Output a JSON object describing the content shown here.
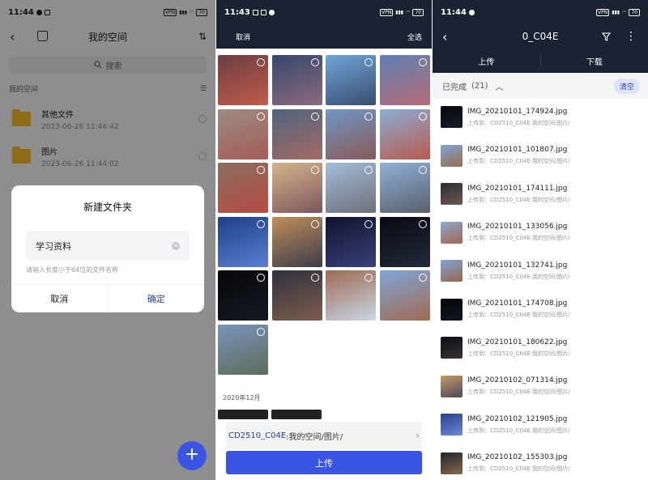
{
  "panel1": {
    "status": {
      "time": "11:44",
      "vpn": "VPN",
      "battery": "70"
    },
    "title": "我的空间",
    "search_placeholder": "搜索",
    "section_label": "我的空间",
    "files": [
      {
        "name": "其他文件",
        "date": "2023-06-26 11:44:42"
      },
      {
        "name": "图片",
        "date": "2023-06-26 11:44:02"
      }
    ],
    "dialog": {
      "title": "新建文件夹",
      "input_value": "学习资料",
      "hint": "请输入长度小于64位的文件名称",
      "cancel": "取消",
      "confirm": "确定"
    },
    "fab_label": "+"
  },
  "panel2": {
    "status": {
      "time": "11:43",
      "vpn": "VPN",
      "battery": "70"
    },
    "cancel": "取消",
    "select_all": "全选",
    "month_label": "2020年12月",
    "thumbs": [
      {
        "c1": "#6b3e43",
        "c2": "#c25c4b"
      },
      {
        "c1": "#36476c",
        "c2": "#8c6a7d"
      },
      {
        "c1": "#6fa5d8",
        "c2": "#3b4d6f"
      },
      {
        "c1": "#5b80b3",
        "c2": "#b86b78"
      },
      {
        "c1": "#9b8c82",
        "c2": "#a65b58"
      },
      {
        "c1": "#4f647f",
        "c2": "#a36a62"
      },
      {
        "c1": "#6f96c7",
        "c2": "#8a5a57"
      },
      {
        "c1": "#8aaed6",
        "c2": "#b8594b"
      },
      {
        "c1": "#8b6d61",
        "c2": "#b54c43"
      },
      {
        "c1": "#d6b58a",
        "c2": "#7e555d"
      },
      {
        "c1": "#a3bddb",
        "c2": "#6e6f79"
      },
      {
        "c1": "#8fb1d8",
        "c2": "#5a5f6c"
      },
      {
        "c1": "#1f3f86",
        "c2": "#5a7fd1"
      },
      {
        "c1": "#c08e58",
        "c2": "#3c3c4a"
      },
      {
        "c1": "#10142c",
        "c2": "#3b3f7a"
      },
      {
        "c1": "#080a12",
        "c2": "#232a3a"
      },
      {
        "c1": "#06070a",
        "c2": "#151922"
      },
      {
        "c1": "#2f3140",
        "c2": "#7d5d4c"
      },
      {
        "c1": "#9e6a52",
        "c2": "#c9d6e6"
      },
      {
        "c1": "#7ea6d8",
        "c2": "#a26a52"
      },
      {
        "c1": "#7893bd",
        "c2": "#5e6d58"
      }
    ],
    "dest_device": "CD2510_C04E",
    "dest_path": ":我的空间/图片/",
    "upload": "上传"
  },
  "panel3": {
    "status": {
      "time": "11:44",
      "vpn": "VPN",
      "battery": "70"
    },
    "title": "0_C04E",
    "tab_upload": "上传",
    "tab_download": "下载",
    "done_label": "已完成",
    "done_count": "(21)",
    "clear": "清空",
    "items": [
      {
        "name": "IMG_20210101_174924.jpg",
        "dest": "上传到：CD2510_C04E 我的空间/图片/",
        "c1": "#05060a",
        "c2": "#1a1e2a"
      },
      {
        "name": "IMG_20210101_101807.jpg",
        "dest": "上传到：CD2510_C04E 我的空间/图片/",
        "c1": "#7fa7d6",
        "c2": "#9b6a4d"
      },
      {
        "name": "IMG_20210101_174111.jpg",
        "dest": "上传到：CD2510_C04E 我的空间/图片/",
        "c1": "#2a2c36",
        "c2": "#6d5a4e"
      },
      {
        "name": "IMG_20210101_133056.jpg",
        "dest": "上传到：CD2510_C04E 我的空间/图片/",
        "c1": "#8ba9cf",
        "c2": "#a66452"
      },
      {
        "name": "IMG_20210101_132741.jpg",
        "dest": "上传到：CD2510_C04E 我的空间/图片/",
        "c1": "#7ea5d5",
        "c2": "#9a6550"
      },
      {
        "name": "IMG_20210101_174708.jpg",
        "dest": "上传到：CD2510_C04E 我的空间/图片/",
        "c1": "#05060a",
        "c2": "#121620"
      },
      {
        "name": "IMG_20210101_180622.jpg",
        "dest": "上传到：CD2510_C04E 我的空间/图片/",
        "c1": "#0b0d18",
        "c2": "#3a3230"
      },
      {
        "name": "IMG_20210102_071314.jpg",
        "dest": "上传到：CD2510_C04E 我的空间/图片/",
        "c1": "#c49a6a",
        "c2": "#4a4a55"
      },
      {
        "name": "IMG_20210102_121905.jpg",
        "dest": "上传到：CD2510_C04E 我的空间/图片/",
        "c1": "#2a3f88",
        "c2": "#6d8ad8"
      },
      {
        "name": "IMG_20210102_155303.jpg",
        "dest": "上传到：CD2510_C04E 我的空间/图片/",
        "c1": "#20222e",
        "c2": "#8a6a4c"
      }
    ]
  },
  "colors": {
    "accent": "#3a55e6",
    "header_dark": "#1b2332",
    "folder": "#f5b829",
    "confirm": "#2c3ea0"
  }
}
